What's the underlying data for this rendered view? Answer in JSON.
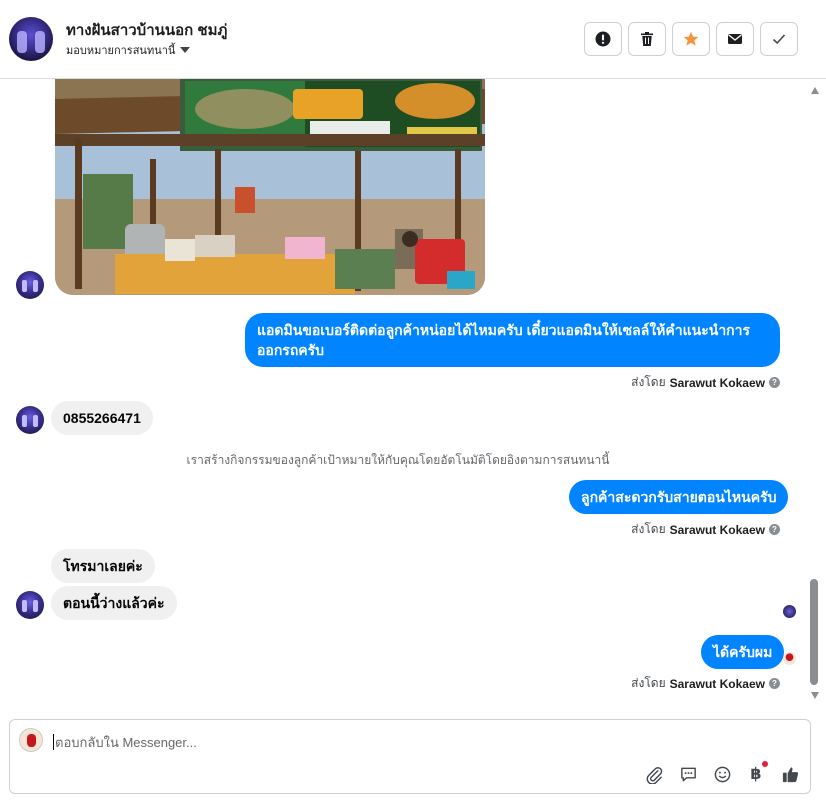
{
  "header": {
    "title": "ทางฝันสาวบ้านนอก ชมภู่",
    "assign_label": "มอบหมายการสนทนานี้"
  },
  "messages": {
    "outgoing_1": "แอดมินขอเบอร์ติดต่อลูกค้าหน่อยได้ไหมครับ เดี๋ยวแอดมินให้เซลล์ให้คำแนะนำการออกรถครับ",
    "incoming_phone": "0855266471",
    "system_notice": "เราสร้างกิจกรรมของลูกค้าเป้าหมายให้กับคุณโดยอัตโนมัติโดยอิงตามการสนทนานี้",
    "outgoing_2": "ลูกค้าสะดวกรับสายตอนไหนครับ",
    "incoming_2": "โทรมาเลยค่ะ",
    "incoming_3": "ตอนนี้ว่างแล้วค่ะ",
    "outgoing_3": "ได้ครับผม"
  },
  "sent_by": {
    "prefix": "ส่งโดย",
    "name": "Sarawut Kokaew"
  },
  "composer": {
    "placeholder": "ตอบกลับใน Messenger...",
    "baht_symbol": "฿"
  },
  "colors": {
    "outgoing_bubble": "#0084ff",
    "incoming_bubble": "#f0f0f0",
    "star": "#f5923e"
  },
  "icons": {
    "spam": "exclamation-circle-icon",
    "delete": "trash-icon",
    "star": "star-icon",
    "unread": "envelope-icon",
    "done": "checkmark-icon",
    "attach": "paperclip-icon",
    "saved_replies": "chat-bubble-icon",
    "emoji": "smiley-icon",
    "payment": "baht-icon",
    "like": "thumbs-up-icon"
  }
}
